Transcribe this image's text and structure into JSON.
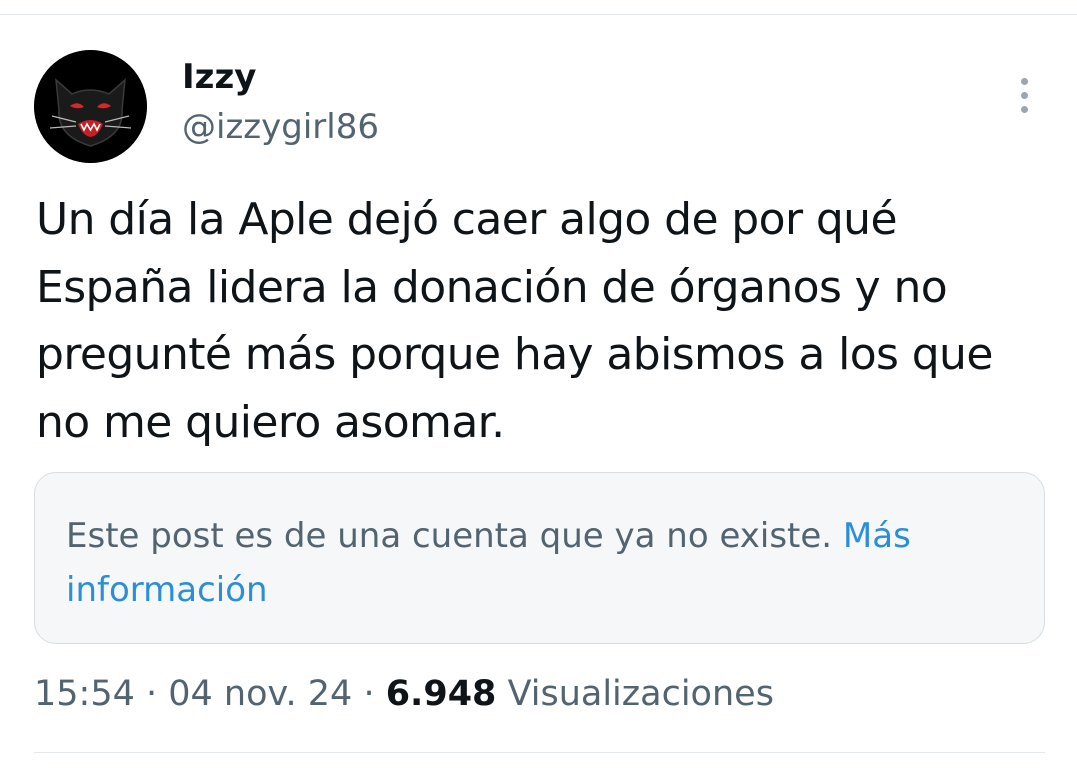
{
  "author": {
    "display_name": "Izzy",
    "handle": "@izzygirl86",
    "avatar_icon": "black-cat-avatar"
  },
  "tweet": {
    "text": "Un día la Aple dejó caer algo de por qué España lidera la donación de órganos y no pregunté más porque hay abismos a los que no me quiero asomar."
  },
  "notice": {
    "text": "Este post es de una cuenta que ya no existe.",
    "link_label": "Más información"
  },
  "meta": {
    "time": "15:54",
    "separator": " · ",
    "date": "04 nov. 24",
    "views_count": "6.948",
    "views_label": "Visualizaciones"
  },
  "icons": {
    "more": "more-vertical-icon"
  },
  "colors": {
    "text_primary": "#0f1419",
    "text_secondary": "#536471",
    "link": "#2b8fd6",
    "notice_bg": "#f6f7f8",
    "divider": "#e6e9eb"
  }
}
